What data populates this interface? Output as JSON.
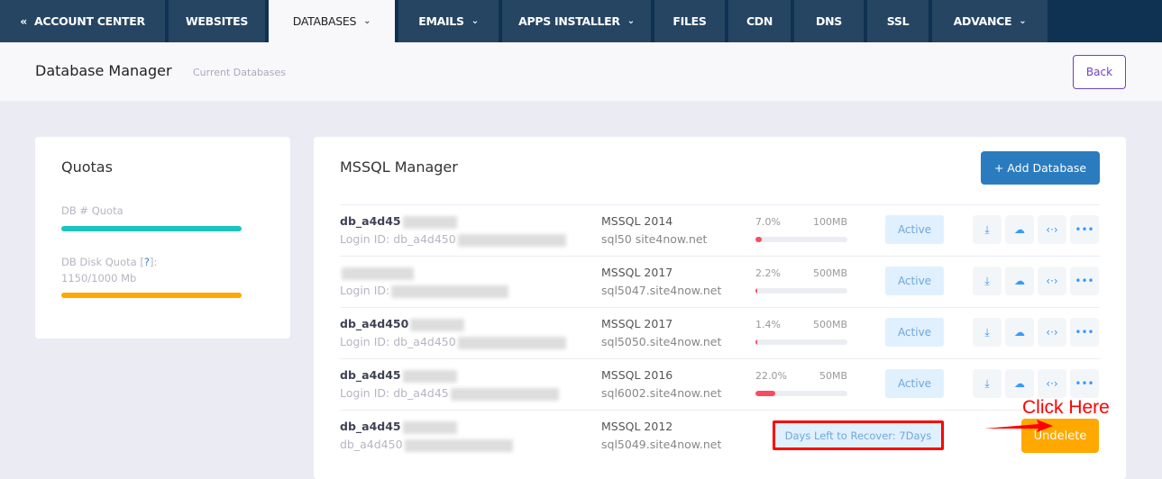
{
  "nav": {
    "tabs": [
      {
        "label": "ACCOUNT CENTER",
        "icon": "double-chevron-left-icon"
      },
      {
        "label": "WEBSITES"
      },
      {
        "label": "DATABASES",
        "dropdown": true,
        "active": true
      },
      {
        "label": "EMAILS",
        "dropdown": true
      },
      {
        "label": "APPS INSTALLER",
        "dropdown": true
      },
      {
        "label": "FILES"
      },
      {
        "label": "CDN"
      },
      {
        "label": "DNS"
      },
      {
        "label": "SSL"
      },
      {
        "label": "ADVANCE",
        "dropdown": true
      }
    ]
  },
  "header": {
    "title": "Database Manager",
    "subtitle": "Current Databases",
    "back_label": "Back"
  },
  "quotas": {
    "title": "Quotas",
    "db_quota_label": "DB # Quota",
    "disk_quota_label": "DB Disk Quota [",
    "disk_quota_q": "?",
    "disk_quota_end": "]:",
    "disk_quota_value": "1150/1000 Mb",
    "colors": {
      "db": "#1bc5bd",
      "disk": "#ffa800"
    }
  },
  "manager": {
    "title": "MSSQL Manager",
    "add_label": "+ Add Database",
    "rows": [
      {
        "name": "db_a4d45",
        "login": "Login ID: db_a4d450",
        "version": "MSSQL 2014",
        "server": "sql50 site4now.net",
        "percent": "7.0%",
        "usage": 7.0,
        "size": "100MB",
        "status": "Active"
      },
      {
        "name": "",
        "login": "Login ID:",
        "version": "MSSQL 2017",
        "server": "sql5047.site4now.net",
        "percent": "2.2%",
        "usage": 2.2,
        "size": "500MB",
        "status": "Active"
      },
      {
        "name": "db_a4d450",
        "login": "Login ID: db_a4d450",
        "version": "MSSQL 2017",
        "server": "sql5050.site4now.net",
        "percent": "1.4%",
        "usage": 1.4,
        "size": "500MB",
        "status": "Active"
      },
      {
        "name": "db_a4d45",
        "login": "Login ID: db_a4d45",
        "version": "MSSQL 2016",
        "server": "sql6002.site4now.net",
        "percent": "22.0%",
        "usage": 22.0,
        "size": "50MB",
        "status": "Active"
      }
    ],
    "deleted_row": {
      "name": "db_a4d45",
      "login": "db_a4d450",
      "version": "MSSQL 2012",
      "server": "sql5049.site4now.net",
      "days_left": "Days Left to Recover: 7Days",
      "undelete_label": "Undelete"
    }
  },
  "annotation": {
    "text": "Click Here"
  }
}
